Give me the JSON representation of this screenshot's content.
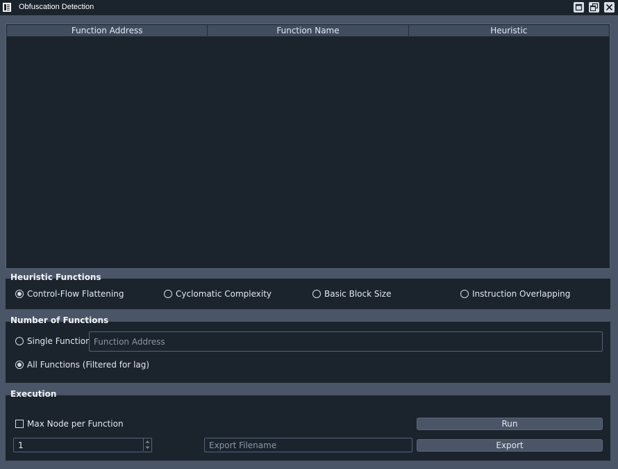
{
  "window": {
    "title": "Obfuscation Detection",
    "icons": [
      "app-icon",
      "maximize-icon",
      "restore-icon",
      "close-icon"
    ]
  },
  "table": {
    "columns": [
      "Function Address",
      "Function Name",
      "Heuristic"
    ],
    "rows": []
  },
  "heuristics": {
    "title": "Heuristic Functions",
    "options": [
      {
        "label": "Control-Flow Flattening",
        "selected": true
      },
      {
        "label": "Cyclomatic Complexity",
        "selected": false
      },
      {
        "label": "Basic Block Size",
        "selected": false
      },
      {
        "label": "Instruction Overlapping",
        "selected": false
      }
    ]
  },
  "functions": {
    "title": "Number of Functions",
    "single_label": "Single Function",
    "single_selected": false,
    "address_placeholder": "Function Address",
    "address_value": "",
    "all_label": "All Functions (Filtered for lag)",
    "all_selected": true
  },
  "execution": {
    "title": "Execution",
    "max_node_label": "Max Node per Function",
    "max_node_checked": false,
    "max_node_value": "1",
    "export_placeholder": "Export Filename",
    "run_label": "Run",
    "export_label": "Export"
  },
  "colors": {
    "titlebar": "#1b232d",
    "window_bg": "#4a5667",
    "panel_bg": "#1b232d",
    "header_bg": "#404d5f"
  }
}
